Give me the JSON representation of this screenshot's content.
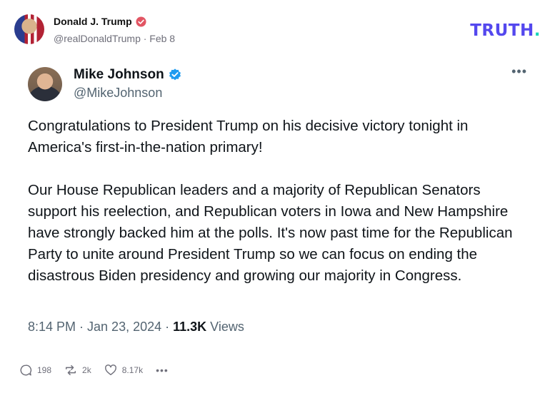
{
  "truth_post": {
    "author_name": "Donald J. Trump",
    "author_meta": "@realDonaldTrump · Feb 8",
    "brand": {
      "logo_text": "TRUTH",
      "logo_dot": ".",
      "color_primary": "#5448ee",
      "color_dot": "#1ad7b9"
    },
    "actions": {
      "replies": "198",
      "retruths": "2k",
      "likes": "8.17k",
      "more": "•••"
    }
  },
  "embedded_tweet": {
    "name": "Mike Johnson",
    "handle": "@MikeJohnson",
    "more": "•••",
    "paragraph_1": "Congratulations to President Trump on his decisive victory tonight in America's first-in-the-nation primary!",
    "paragraph_2": "Our House Republican leaders and a majority of Republican Senators support his reelection, and Republican voters in Iowa and New Hampshire have strongly backed him at the polls. It's now past time for the Republican Party to unite around President Trump so we can focus on ending the disastrous Biden presidency and growing our majority in Congress.",
    "timestamp": "8:14 PM · Jan 23, 2024 · ",
    "views_count": "11.3K",
    "views_label": " Views",
    "verified_color": "#1d9bf0"
  }
}
